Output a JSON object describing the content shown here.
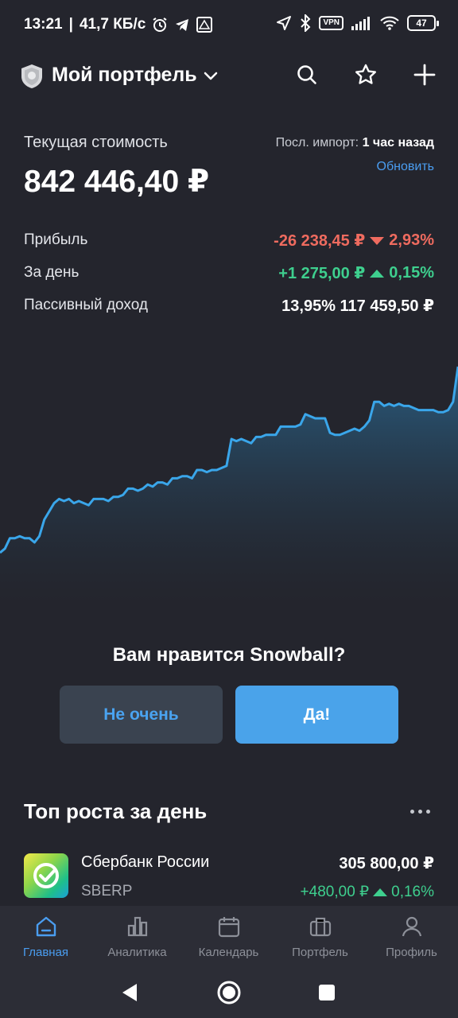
{
  "status_bar": {
    "time": "13:21",
    "net_speed": "41,7 КБ/с",
    "vpn": "VPN",
    "battery": "47"
  },
  "header": {
    "title": "Мой портфель"
  },
  "summary": {
    "current_value_label": "Текущая стоимость",
    "current_value": "842 446,40 ₽",
    "import_label": "Посл. импорт:",
    "import_time": "1 час назад",
    "refresh_label": "Обновить",
    "profit_label": "Прибыль",
    "profit_value": "-26 238,45 ₽",
    "profit_pct": "2,93%",
    "day_label": "За день",
    "day_value": "+1 275,00 ₽",
    "day_pct": "0,15%",
    "passive_label": "Пассивный доход",
    "passive_value": "13,95% 117 459,50 ₽"
  },
  "portfolio_chart": {
    "type": "area",
    "line_color": "#3aa6ea",
    "values": [
      0.05,
      0.07,
      0.12,
      0.12,
      0.13,
      0.12,
      0.12,
      0.1,
      0.13,
      0.21,
      0.25,
      0.29,
      0.31,
      0.3,
      0.31,
      0.29,
      0.3,
      0.29,
      0.28,
      0.31,
      0.31,
      0.31,
      0.3,
      0.32,
      0.32,
      0.33,
      0.36,
      0.36,
      0.35,
      0.36,
      0.38,
      0.37,
      0.39,
      0.39,
      0.38,
      0.41,
      0.41,
      0.42,
      0.42,
      0.41,
      0.45,
      0.45,
      0.44,
      0.45,
      0.45,
      0.46,
      0.47,
      0.6,
      0.59,
      0.6,
      0.59,
      0.58,
      0.61,
      0.61,
      0.62,
      0.62,
      0.62,
      0.66,
      0.66,
      0.66,
      0.66,
      0.67,
      0.72,
      0.71,
      0.7,
      0.7,
      0.7,
      0.63,
      0.62,
      0.62,
      0.63,
      0.64,
      0.65,
      0.64,
      0.66,
      0.69,
      0.78,
      0.78,
      0.76,
      0.77,
      0.76,
      0.77,
      0.76,
      0.76,
      0.75,
      0.74,
      0.74,
      0.74,
      0.74,
      0.73,
      0.73,
      0.74,
      0.78,
      0.95
    ]
  },
  "feedback": {
    "question": "Вам нравится Snowball?",
    "no_label": "Не очень",
    "yes_label": "Да!"
  },
  "top_growth": {
    "title": "Топ роста за день",
    "items": [
      {
        "name": "Сбербанк России",
        "ticker": "SBERP",
        "price": "305 800,00 ₽",
        "change": "+480,00 ₽",
        "change_pct": "0,16%"
      }
    ]
  },
  "bottom_nav": {
    "items": [
      {
        "label": "Главная",
        "icon": "home-icon",
        "active": true
      },
      {
        "label": "Аналитика",
        "icon": "analytics-icon",
        "active": false
      },
      {
        "label": "Календарь",
        "icon": "calendar-icon",
        "active": false
      },
      {
        "label": "Портфель",
        "icon": "briefcase-icon",
        "active": false
      },
      {
        "label": "Профиль",
        "icon": "profile-icon",
        "active": false
      }
    ]
  },
  "colors": {
    "background": "#24252d",
    "accent": "#4a9df0",
    "positive": "#3ecf8e",
    "negative": "#ef6b5f"
  }
}
